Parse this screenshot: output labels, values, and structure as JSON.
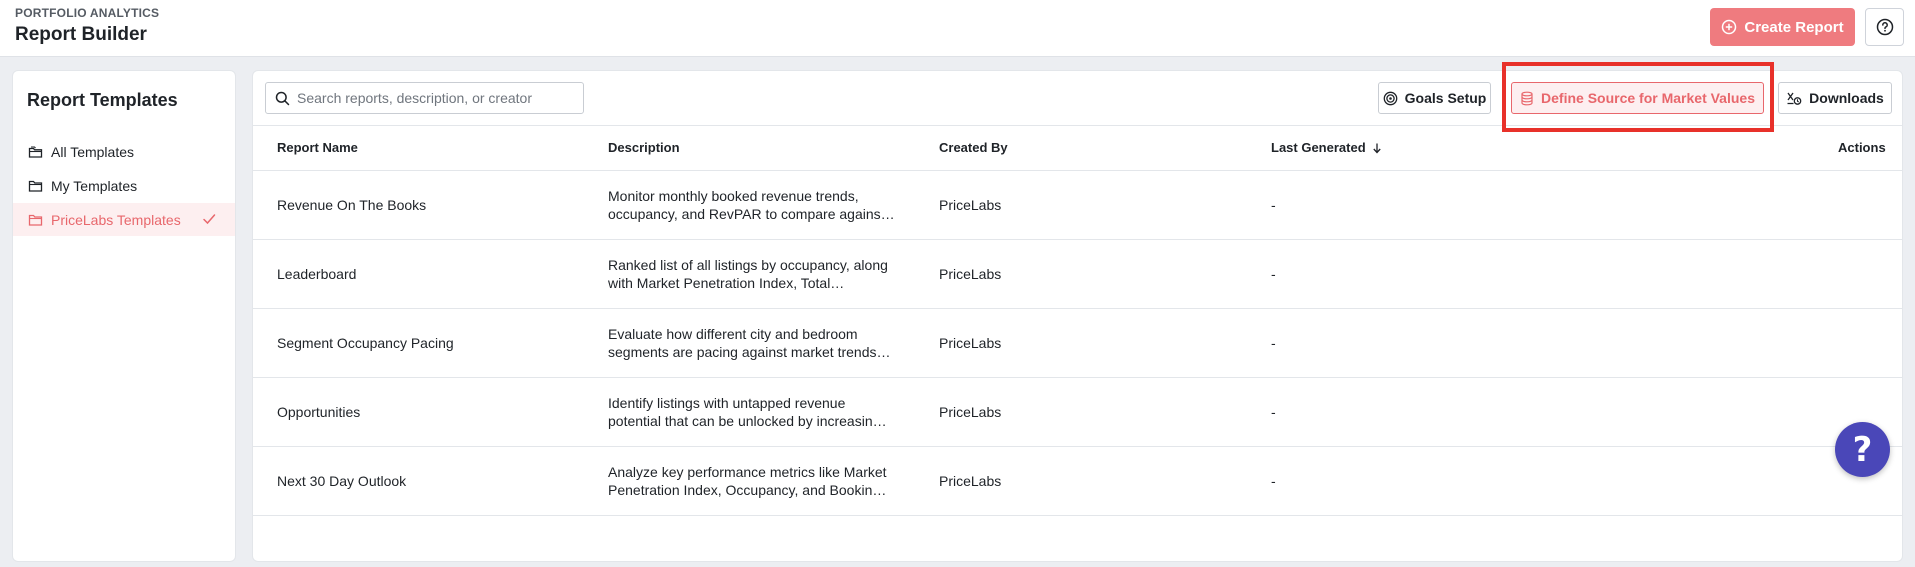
{
  "header": {
    "eyebrow": "PORTFOLIO ANALYTICS",
    "title": "Report Builder",
    "create_label": "Create Report"
  },
  "sidebar": {
    "title": "Report Templates",
    "items": [
      {
        "label": "All Templates",
        "icon": "folders-icon"
      },
      {
        "label": "My Templates",
        "icon": "folder-icon"
      },
      {
        "label": "PriceLabs Templates",
        "icon": "folder-icon",
        "active": true
      }
    ]
  },
  "toolbar": {
    "search_placeholder": "Search reports, description, or creator",
    "goals_label": "Goals Setup",
    "source_label": "Define Source for Market Values",
    "downloads_label": "Downloads"
  },
  "table": {
    "columns": [
      "Report Name",
      "Description",
      "Created By",
      "Last Generated",
      "Actions"
    ],
    "rows": [
      {
        "name": "Revenue On The Books",
        "desc1": "Monitor monthly booked revenue trends,",
        "desc2": "occupancy, and RevPAR to compare agains…",
        "creator": "PriceLabs",
        "last": "-"
      },
      {
        "name": "Leaderboard",
        "desc1": "Ranked list of all listings by occupancy, along",
        "desc2": "with Market Penetration Index, Total…",
        "creator": "PriceLabs",
        "last": "-"
      },
      {
        "name": "Segment Occupancy Pacing",
        "desc1": "Evaluate how different city and bedroom",
        "desc2": "segments are pacing against market trends…",
        "creator": "PriceLabs",
        "last": "-"
      },
      {
        "name": "Opportunities",
        "desc1": "Identify listings with untapped revenue",
        "desc2": "potential that can be unlocked by increasin…",
        "creator": "PriceLabs",
        "last": "-"
      },
      {
        "name": "Next 30 Day Outlook",
        "desc1": "Analyze key performance metrics like Market",
        "desc2": "Penetration Index, Occupancy, and Bookin…",
        "creator": "PriceLabs",
        "last": "-"
      }
    ]
  },
  "colors": {
    "accent": "#e8676c",
    "create_bg": "#ef7b7f",
    "highlight": "#e8312a",
    "chat": "#4a47b8"
  },
  "chat": {
    "glyph": "?"
  }
}
